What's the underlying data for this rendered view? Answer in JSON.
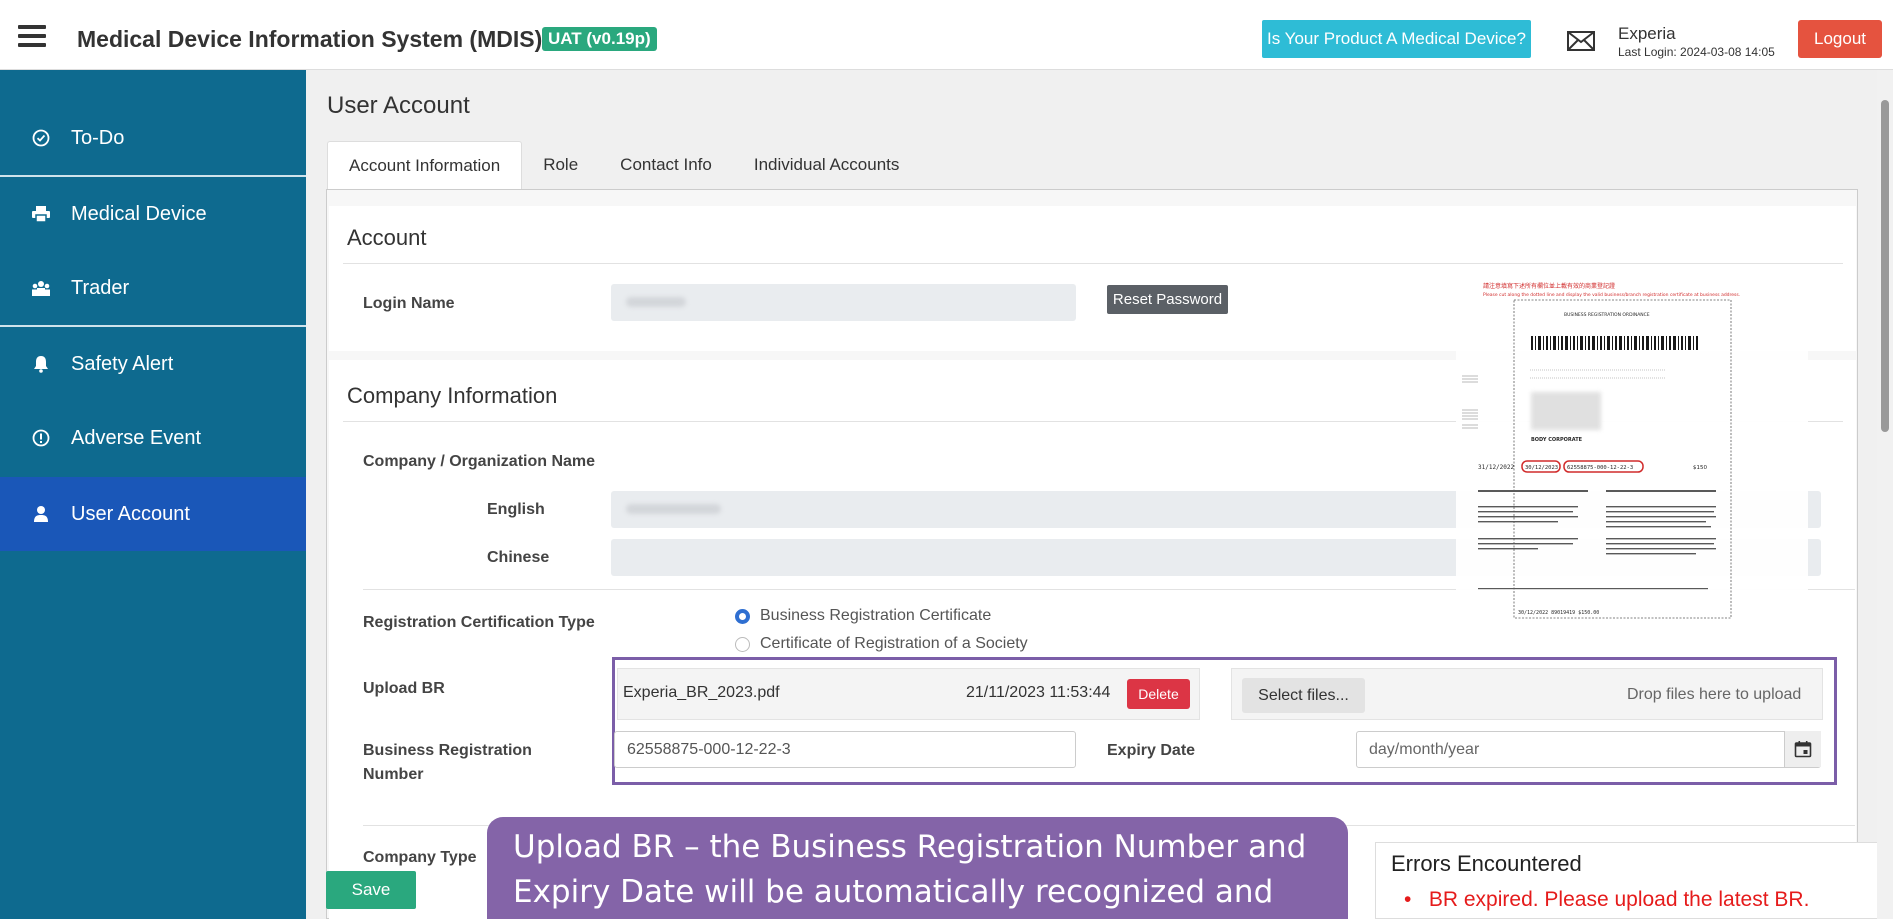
{
  "header": {
    "app_title": "Medical Device Information System (MDIS)",
    "env_badge": "UAT (v0.19p)",
    "medical_device_button": "Is Your Product A Medical Device?",
    "user_name": "Experia",
    "last_login": "Last Login: 2024-03-08 14:05",
    "logout_label": "Logout"
  },
  "sidebar": {
    "items": [
      {
        "label": "To-Do",
        "icon": "check-circle-icon"
      },
      {
        "label": "Medical Device",
        "icon": "printer-icon"
      },
      {
        "label": "Trader",
        "icon": "users-icon"
      },
      {
        "label": "Safety Alert",
        "icon": "bell-icon"
      },
      {
        "label": "Adverse Event",
        "icon": "exclamation-circle-icon"
      },
      {
        "label": "User Account",
        "icon": "user-icon"
      }
    ],
    "active": "User Account"
  },
  "page": {
    "title": "User Account",
    "tabs": [
      "Account Information",
      "Role",
      "Contact Info",
      "Individual Accounts"
    ]
  },
  "account": {
    "section_title": "Account",
    "login_name_label": "Login Name",
    "reset_password_label": "Reset Password"
  },
  "company": {
    "section_title": "Company Information",
    "org_name_label": "Company / Organization Name",
    "english_label": "English",
    "chinese_label": "Chinese",
    "reg_type_label": "Registration Certification Type",
    "reg_type_options": [
      "Business Registration Certificate",
      "Certificate of Registration of a Society"
    ],
    "reg_type_selected": "Business Registration Certificate",
    "upload_label": "Upload BR",
    "file_name": "Experia_BR_2023.pdf",
    "file_uploaded_at": "21/11/2023 11:53:44",
    "delete_label": "Delete",
    "select_files_label": "Select files...",
    "drop_text": "Drop files here to upload",
    "br_number_label_1": "Business Registration",
    "br_number_label_2": "Number",
    "br_number_value": "62558875-000-12-22-3",
    "expiry_label": "Expiry Date",
    "expiry_placeholder": "day/month/year",
    "company_type_label": "Company Type"
  },
  "footer": {
    "save_label": "Save"
  },
  "callout": {
    "line1": "Upload BR – the Business Registration Number and",
    "line2": "Expiry Date will be automatically recognized and"
  },
  "errors": {
    "title": "Errors Encountered",
    "items": [
      "BR expired. Please upload the latest BR."
    ]
  },
  "document": {
    "top_note": "請注意填寫下述所有欄位並上載有效的商業登記證",
    "top_note_en": "Please cut along the dotted line and display the valid business/branch registration certificate at business address.",
    "ordinance": "BUSINESS REGISTRATION ORDINANCE",
    "body_corporate": "BODY CORPORATE",
    "doc_date": "31/12/2022",
    "expiry": "30/12/2023",
    "number": "62558875-000-12-22-3",
    "fee": "$150",
    "footer_line": "30/12/2022  89019419  $150.00"
  },
  "colors": {
    "sidebar_bg": "#0e6a8f",
    "sidebar_active": "#1a57b8",
    "badge": "#2aa87e",
    "info_button": "#2ebcd6",
    "logout": "#e5533f",
    "callout": "#8464a8",
    "error_text": "#e51b1b"
  }
}
